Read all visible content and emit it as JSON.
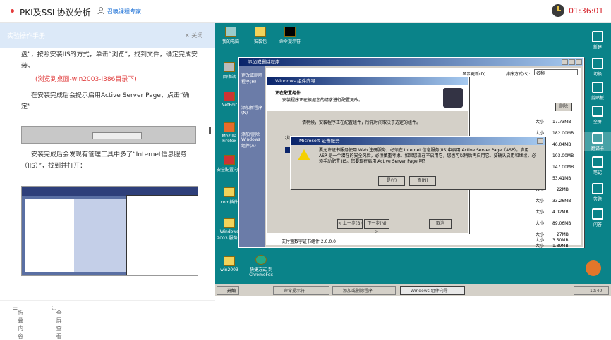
{
  "header": {
    "title": "PKI及SSL协议分析",
    "expert": "召唤课程专家",
    "timer": "01:36:01"
  },
  "left": {
    "panel_title": "实验操作手册",
    "close": "关闭",
    "p1": "盘”，按照安装IIS的方式，单击“浏览”，找到文件，确定完成安装。",
    "p1_red": "(浏览到桌面-win2003-I386目录下)",
    "p2": "在安装完成后会提示启用Active Server Page，点击“确定”",
    "p3": "安装完成后会发现有管理工具中多了“Internet信息服务（IIS）”，找到并打开：",
    "foot_collapse": "折叠内容",
    "foot_full": "全屏查看"
  },
  "desktop": {
    "icons": [
      "我的电脑",
      "安装包",
      "命令提示符",
      "回收站",
      "NetEdit",
      "Mozilla Firefox",
      "安全配置向导",
      "com插件",
      "Windows 2003 服务器",
      "win2003",
      "快捷方式 到 ChromeFox"
    ],
    "addremove_title": "添加或删除程序",
    "sort_label": "排序方式(S):",
    "sort_value": "名称",
    "show_updates": "显示更新(D)",
    "remove": "删除",
    "sizes": [
      "17.73MB",
      "182.00MB",
      "46.04MB",
      "103.00MB",
      "147.00MB",
      "53.41MB",
      "22MB",
      "33.26MB",
      "4.02MB",
      "89.06MB",
      "27MB",
      "3.50MB",
      "1.89MB"
    ],
    "size_label": "大小",
    "side_items": [
      "更改或删除程序(H)",
      "添加新程序(N)",
      "添加/删除Windows组件(A)"
    ],
    "last_row": "支付宝数字证书组件 2.0.0.0",
    "wizard_title": "Windows 组件向导",
    "wizard_h": "正在配置组件",
    "wizard_sub": "安装程序正在根据您的请求进行配置更改。",
    "wizard_wait": "请稍候，安装程序正在配置组件，所花时间取决于选定的组件。",
    "wizard_status": "状态:",
    "wiz_back": "< 上一步(B)",
    "wiz_next": "下一步(N) >",
    "wiz_cancel": "取消",
    "cert_title": "Microsoft 证书服务",
    "cert_msg": "要允许证书服务使用 Web 注册服务，必须在 Internet 信息服务(IIS)中启用 Active Server Page（ASP）。启用 ASP 是一个潜在的安全风险，必须慎重考虑。如果您现在不启用它，您也可以稍后再启用它。要确认启用和继续，必须手动配置 IIS。您要现在启用 Active Server Page 吗？",
    "cert_yes": "是(Y)",
    "cert_no": "否(N)"
  },
  "taskbar": {
    "start": "开始",
    "items": [
      "命令提示符",
      "添加或删除程序",
      "Windows 组件向导"
    ],
    "time": "10:40"
  },
  "rside": [
    "新建",
    "切换",
    "剪贴板",
    "全屏",
    "翻译卡",
    "笔记",
    "答题",
    "问答"
  ]
}
